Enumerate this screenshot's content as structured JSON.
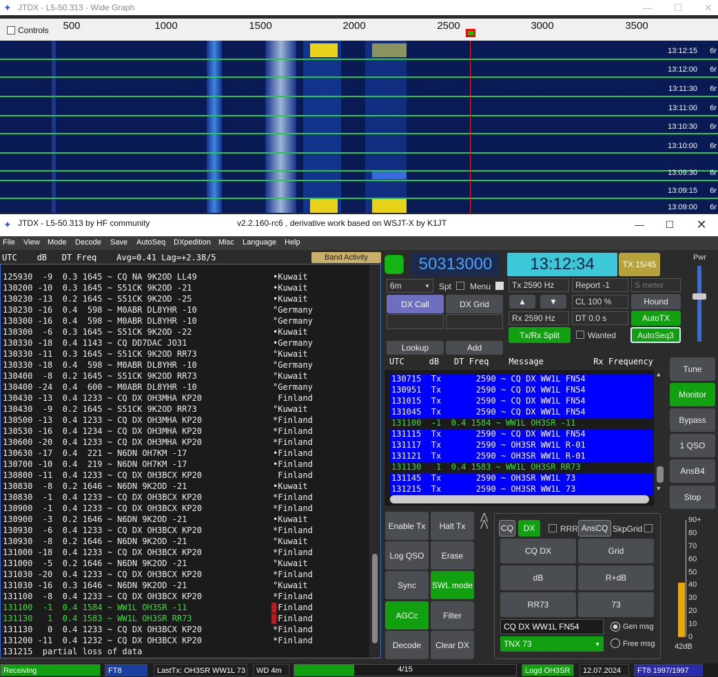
{
  "wide_graph": {
    "title": "JTDX - L5-50.313 - Wide Graph",
    "controls_label": "Controls",
    "scale_ticks": [
      "500",
      "1000",
      "1500",
      "2000",
      "2500",
      "3000",
      "3500"
    ],
    "times": [
      "13:12:15",
      "13:12:00",
      "13:11:30",
      "13:11:00",
      "13:10:30",
      "13:10:00",
      "13:09:30",
      "13:09:15",
      "13:09:00"
    ],
    "band_label": "6r"
  },
  "main_window": {
    "title": "JTDX - L5-50.313  by HF community",
    "subtitle": "v2.2.160-rc6 , derivative work based on WSJT-X by K1JT"
  },
  "menu": [
    "File",
    "View",
    "Mode",
    "Decode",
    "Save",
    "AutoSeq",
    "DXpedition",
    "Misc",
    "Language",
    "Help"
  ],
  "band_activity": {
    "header": "UTC    dB   DT Freq    Avg=0.41 Lag=+2.38/5",
    "button": "Band Activity",
    "rows": [
      {
        "text": "125930  -9  0.3 1645 ~ CQ NA 9K2OD LL49",
        "country": "•Kuwait",
        "green": false
      },
      {
        "text": "130200 -10  0.3 1645 ~ S51CK 9K2OD -21",
        "country": "•Kuwait",
        "green": false
      },
      {
        "text": "130230 -13  0.2 1645 ~ S51CK 9K2OD -25",
        "country": "•Kuwait",
        "green": false
      },
      {
        "text": "130230 -16  0.4  598 ~ M0ABR DL8YHR -10",
        "country": "°Germany",
        "green": false
      },
      {
        "text": "130300 -16  0.4  598 ~ M0ABR DL8YHR -10",
        "country": "°Germany",
        "green": false
      },
      {
        "text": "130300  -6  0.3 1645 ~ S51CK 9K2OD -22",
        "country": "•Kuwait",
        "green": false
      },
      {
        "text": "130330 -18  0.4 1143 ~ CQ DD7DAC JO31",
        "country": "•Germany",
        "green": false
      },
      {
        "text": "130330 -11  0.3 1645 ~ S51CK 9K2OD RR73",
        "country": "°Kuwait",
        "green": false
      },
      {
        "text": "130330 -18  0.4  598 ~ M0ABR DL8YHR -10",
        "country": "°Germany",
        "green": false
      },
      {
        "text": "130400  -8  0.2 1645 ~ S51CK 9K2OD RR73",
        "country": "°Kuwait",
        "green": false
      },
      {
        "text": "130400 -24  0.4  600 ~ M0ABR DL8YHR -10",
        "country": "°Germany",
        "green": false
      },
      {
        "text": "130430 -13  0.4 1233 ~ CQ DX OH3MHA KP20",
        "country": " Finland",
        "green": false
      },
      {
        "text": "130430  -9  0.2 1645 ~ S51CK 9K2OD RR73",
        "country": "°Kuwait",
        "green": false
      },
      {
        "text": "130500 -13  0.4 1233 ~ CQ DX OH3MHA KP20",
        "country": "*Finland",
        "green": false
      },
      {
        "text": "130530 -16  0.4 1234 ~ CQ DX OH3MHA KP20",
        "country": "*Finland",
        "green": false
      },
      {
        "text": "130600 -20  0.4 1233 ~ CQ DX OH3MHA KP20",
        "country": "*Finland",
        "green": false
      },
      {
        "text": "130630 -17  0.4  221 ~ N6DN OH7KM -17",
        "country": "•Finland",
        "green": false
      },
      {
        "text": "130700 -10  0.4  219 ~ N6DN OH7KM -17",
        "country": "•Finland",
        "green": false
      },
      {
        "text": "130800 -11  0.4 1233 ~ CQ DX OH3BCX KP20",
        "country": " Finland",
        "green": false
      },
      {
        "text": "130830  -8  0.2 1646 ~ N6DN 9K2OD -21",
        "country": "•Kuwait",
        "green": false
      },
      {
        "text": "130830  -1  0.4 1233 ~ CQ DX OH3BCX KP20",
        "country": "*Finland",
        "green": false
      },
      {
        "text": "130900  -1  0.4 1233 ~ CQ DX OH3BCX KP20",
        "country": "*Finland",
        "green": false
      },
      {
        "text": "130900  -3  0.2 1646 ~ N6DN 9K2OD -21",
        "country": "•Kuwait",
        "green": false
      },
      {
        "text": "130930  -6  0.4 1233 ~ CQ DX OH3BCX KP20",
        "country": "*Finland",
        "green": false
      },
      {
        "text": "130930  -8  0.2 1646 ~ N6DN 9K2OD -21",
        "country": "°Kuwait",
        "green": false
      },
      {
        "text": "131000 -18  0.4 1233 ~ CQ DX OH3BCX KP20",
        "country": "*Finland",
        "green": false
      },
      {
        "text": "131000  -5  0.2 1646 ~ N6DN 9K2OD -21",
        "country": "°Kuwait",
        "green": false
      },
      {
        "text": "131030 -20  0.4 1233 ~ CQ DX OH3BCX KP20",
        "country": "*Finland",
        "green": false
      },
      {
        "text": "131030 -16  0.3 1646 ~ N6DN 9K2OD -21",
        "country": "°Kuwait",
        "green": false
      },
      {
        "text": "131100  -8  0.4 1233 ~ CQ DX OH3BCX KP20",
        "country": "*Finland",
        "green": false
      },
      {
        "text": "131100  -1  0.4 1584 ~ WW1L OH3SR -11",
        "country": "•Finland",
        "green": true
      },
      {
        "text": "131130   1  0.4 1583 ~ WW1L OH3SR RR73",
        "country": "•Finland",
        "green": true
      },
      {
        "text": "131130   0  0.4 1233 ~ CQ DX OH3BCX KP20",
        "country": "*Finland",
        "green": false
      },
      {
        "text": "131200 -11  0.4 1232 ~ CQ DX OH3BCX KP20",
        "country": "*Finland",
        "green": false
      },
      {
        "text": "131215  partial loss of data",
        "country": "",
        "green": false
      }
    ]
  },
  "top_controls": {
    "frequency": "50313000",
    "clock": "13:12:34",
    "tx_period": "TX 15/45",
    "pwr_label": "Pwr",
    "band": "6m",
    "spt_label": "Spt",
    "menu_label": "Menu",
    "tx_hz": "Tx  2590  Hz",
    "rx_hz": "Rx  2590  Hz",
    "report": "Report -1",
    "s_meter_placeholder": "S meter",
    "cl": "CL  100 %",
    "dt": "DT 0.0 s",
    "hound": "Hound",
    "autotx": "AutoTX",
    "autoseq3": "AutoSeq3",
    "dx_call": "DX Call",
    "dx_grid": "DX Grid",
    "split": "Tx/Rx Split",
    "wanted": "Wanted",
    "lookup": "Lookup",
    "add": "Add",
    "up_arrow": "▲",
    "down_arrow": "▼"
  },
  "rx_frequency": {
    "header": "UTC     dB   DT Freq    Message          Rx Frequency",
    "rows": [
      {
        "text": "130715  Tx       2590 ~ CQ DX WW1L FN54",
        "type": "tx"
      },
      {
        "text": "130951  Tx       2590 ~ CQ DX WW1L FN54",
        "type": "tx"
      },
      {
        "text": "131015  Tx       2590 ~ CQ DX WW1L FN54",
        "type": "tx"
      },
      {
        "text": "131045  Tx       2590 ~ CQ DX WW1L FN54",
        "type": "tx"
      },
      {
        "text": "131100  -1  0.4 1584 ~ WW1L OH3SR -11",
        "type": "rx"
      },
      {
        "text": "131115  Tx       2590 ~ CQ DX WW1L FN54",
        "type": "tx"
      },
      {
        "text": "131117  Tx       2590 ~ OH3SR WW1L R-01",
        "type": "tx"
      },
      {
        "text": "131121  Tx       2590 ~ OH3SR WW1L R-01",
        "type": "tx"
      },
      {
        "text": "131130   1  0.4 1583 ~ WW1L OH3SR RR73",
        "type": "rx"
      },
      {
        "text": "131145  Tx       2590 ~ OH3SR WW1L 73",
        "type": "tx"
      },
      {
        "text": "131215  Tx       2590 ~ OH3SR WW1L 73",
        "type": "tx"
      }
    ]
  },
  "side_buttons": [
    "Tune",
    "Monitor",
    "Bypass",
    "1 QSO",
    "AnsB4",
    "Stop"
  ],
  "bottom_buttons": {
    "enable_tx": "Enable Tx",
    "halt_tx": "Halt Tx",
    "log_qso": "Log QSO",
    "erase": "Erase",
    "sync": "Sync",
    "swl_mode": "SWL mode",
    "agcc": "AGCc",
    "filter": "Filter",
    "decode": "Decode",
    "clear_dx": "Clear DX"
  },
  "messages": {
    "cq": "CQ",
    "dx": "DX",
    "rrr": "RRR",
    "anscq": "AnsCQ",
    "skpgrid": "SkpGrid",
    "cq_dx": "CQ DX",
    "grid": "Grid",
    "db": "dB",
    "r_db": "R+dB",
    "rr73": "RR73",
    "seventy_three": "73",
    "gen_text": "CQ DX WW1L FN54",
    "gen_msg": "Gen msg",
    "free_text": "TNX 73",
    "free_msg": "Free msg"
  },
  "meter": {
    "labels": [
      "90+",
      "80",
      "70",
      "60",
      "50",
      "40",
      "30",
      "20",
      "10",
      "0"
    ],
    "level_db": "42dB",
    "level_value": 42
  },
  "status_bar": {
    "state": "Receiving",
    "mode": "FT8",
    "last_tx": "LastTx: OH3SR WW1L 73",
    "wd": "WD 4m",
    "progress": "4/15",
    "progress_fraction": 0.27,
    "logged": "Logd OH3SR",
    "date": "12.07.2024",
    "mode_count": "FT8  1997/1997"
  },
  "colors": {
    "accent_green": "#10a010",
    "tx_blue": "#0000ff",
    "decode_green": "#33e133",
    "clock_cyan": "#3cc8d8",
    "freq_blue": "#4aa0ff"
  }
}
